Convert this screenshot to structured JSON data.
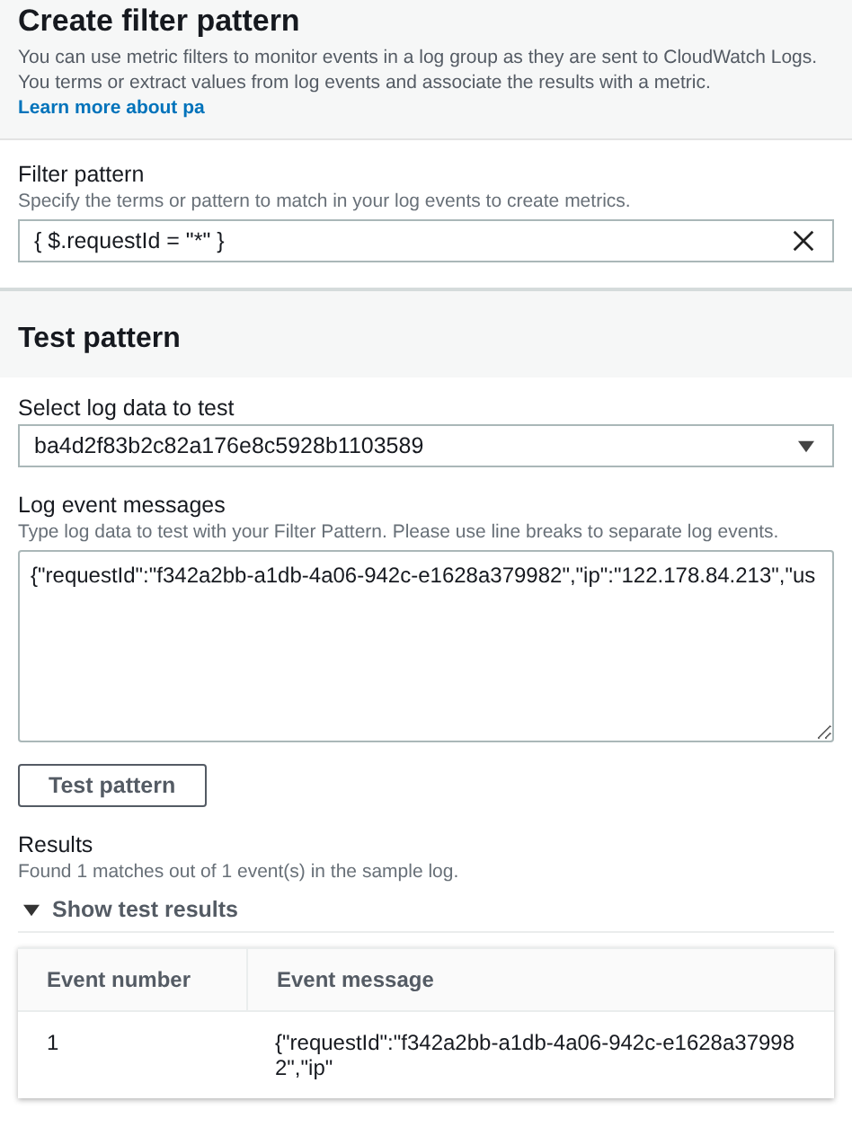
{
  "header": {
    "title": "Create filter pattern",
    "description": "You can use metric filters to monitor events in a log group as they are sent to CloudWatch Logs. You terms or extract values from log events and associate the results with a metric.",
    "link": "Learn more about pa"
  },
  "filter_pattern": {
    "label": "Filter pattern",
    "hint": "Specify the terms or pattern to match in your log events to create metrics.",
    "value": "{ $.requestId = \"*\" }"
  },
  "test_section": {
    "title": "Test pattern"
  },
  "log_data_select": {
    "label": "Select log data to test",
    "value": "ba4d2f83b2c82a176e8c5928b1103589"
  },
  "log_messages": {
    "label": "Log event messages",
    "hint": "Type log data to test with your Filter Pattern. Please use line breaks to separate log events.",
    "value": "{\"requestId\":\"f342a2bb-a1db-4a06-942c-e1628a379982\",\"ip\":\"122.178.84.213\",\"us"
  },
  "test_button": "Test pattern",
  "results": {
    "label": "Results",
    "summary": "Found 1 matches out of 1 event(s) in the sample log.",
    "toggle": "Show test results",
    "expanded": true
  },
  "table": {
    "columns": [
      "Event number",
      "Event message"
    ],
    "rows": [
      [
        "1",
        "{\"requestId\":\"f342a2bb-a1db-4a06-942c-e1628a379982\",\"ip\""
      ]
    ]
  }
}
